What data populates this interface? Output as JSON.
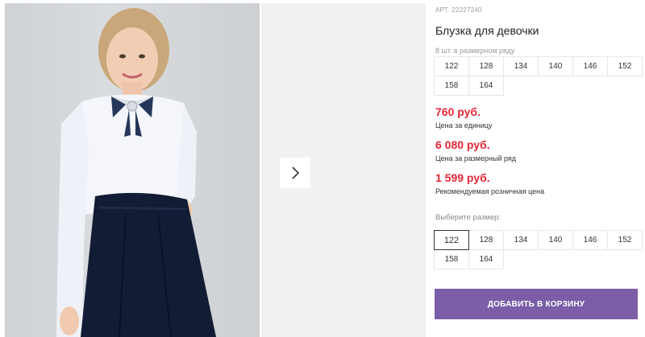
{
  "product": {
    "art_label": "АРТ.",
    "art_number": "22227240",
    "title": "Блузка для девочки",
    "size_row_note": "8 шт. в размерном ряду",
    "size_row": [
      "122",
      "128",
      "134",
      "140",
      "146",
      "152",
      "158",
      "164"
    ]
  },
  "prices": {
    "unit_price": "760 руб.",
    "unit_label": "Цена за единицу",
    "row_price": "6 080 руб.",
    "row_label": "Цена за размерный ряд",
    "retail_price": "1 599 руб.",
    "retail_label": "Рекомендуемая розничная цена",
    "price_color": "#e32636"
  },
  "size_select": {
    "label": "Выберите размер:",
    "options": [
      "122",
      "128",
      "134",
      "140",
      "146",
      "152",
      "158",
      "164"
    ],
    "selected": "122"
  },
  "cart": {
    "button_label": "ДОБАВИТЬ В КОРЗИНУ",
    "button_color": "#7b5ea7"
  },
  "gallery": {
    "next_icon": "chevron-right-icon"
  }
}
